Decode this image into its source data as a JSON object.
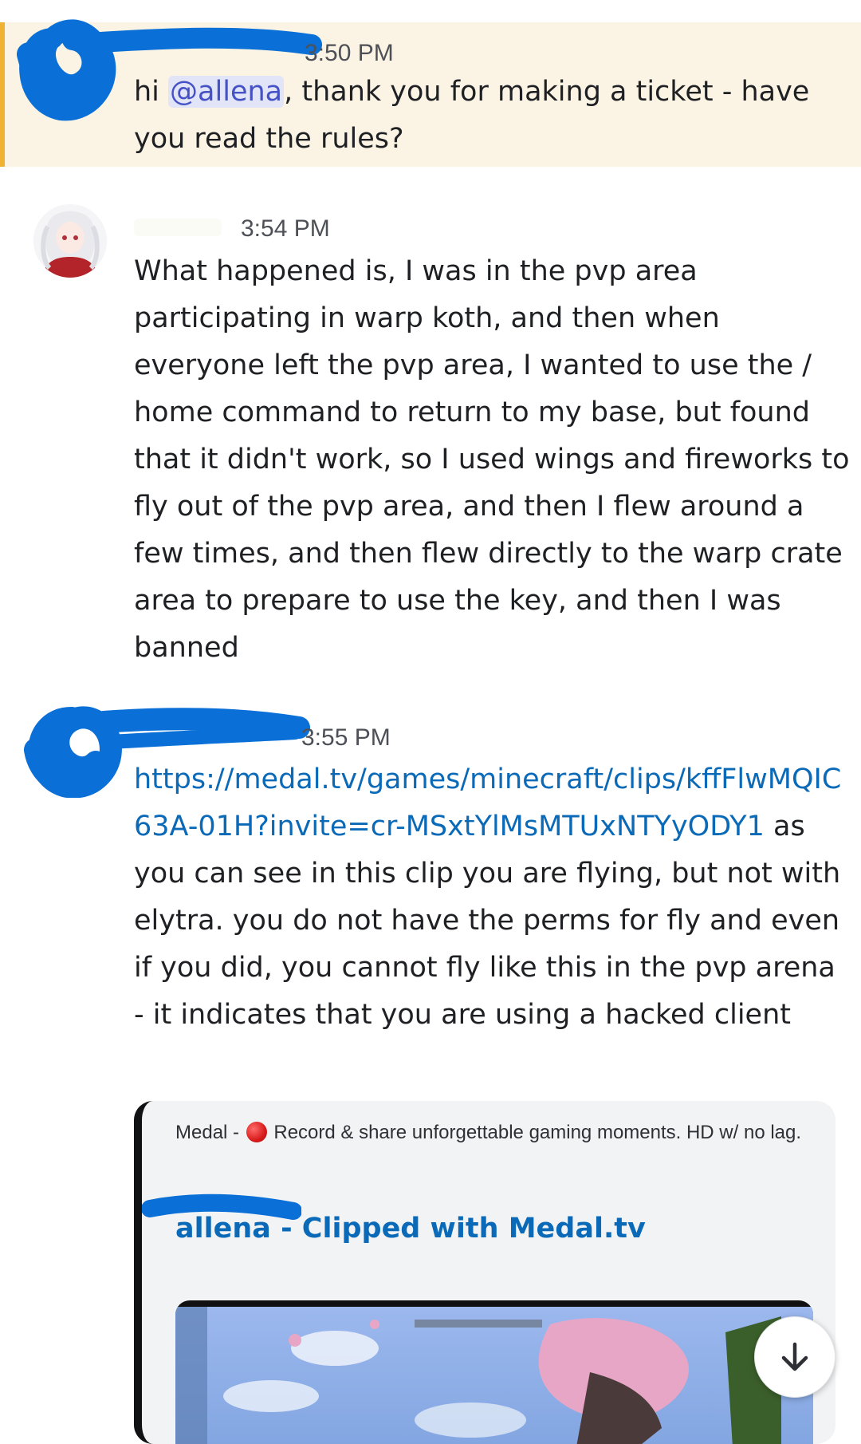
{
  "messages": [
    {
      "timestamp": "3:50 PM",
      "text_before": "hi ",
      "mention": "@allena",
      "text_after": ", thank you for making a ticket - have you read the rules?"
    },
    {
      "timestamp": "3:54 PM",
      "text": "What happened is, I was in the pvp area participating in warp koth, and then when everyone left the pvp area, I wanted to use the / home command to return to my base, but found that it didn't work, so I used wings and fireworks to fly out of the pvp area, and then I flew around a few times, and then flew directly to the warp crate area to prepare to use the key, and then I was banned"
    },
    {
      "timestamp": "3:55 PM",
      "link": "https://medal.tv/games/minecraft/clips/kffFlwMQIC63A-01H?invite=cr-MSxtYlMsMTUxNTYyODY1",
      "text": " as you can see in this clip you are flying, but not with elytra. you do not have the perms for fly and even if you did, you cannot fly like this in the pvp arena - it indicates that you are using a hacked client"
    }
  ],
  "embed": {
    "provider_before": "Medal - ",
    "provider_after": " Record & share unforgettable gaming moments. HD w/ no lag.",
    "title": "allena - Clipped with Medal.tv"
  },
  "colors": {
    "accent_mention_bg": "#e2e4f8",
    "highlight_bg": "#fbf4e4",
    "highlight_bar": "#f0b232",
    "link": "#0b6ab8",
    "redaction": "#0a6fd6"
  },
  "icons": {
    "scroll_down": "arrow-down-icon",
    "embed_dot": "red-circle-icon"
  }
}
